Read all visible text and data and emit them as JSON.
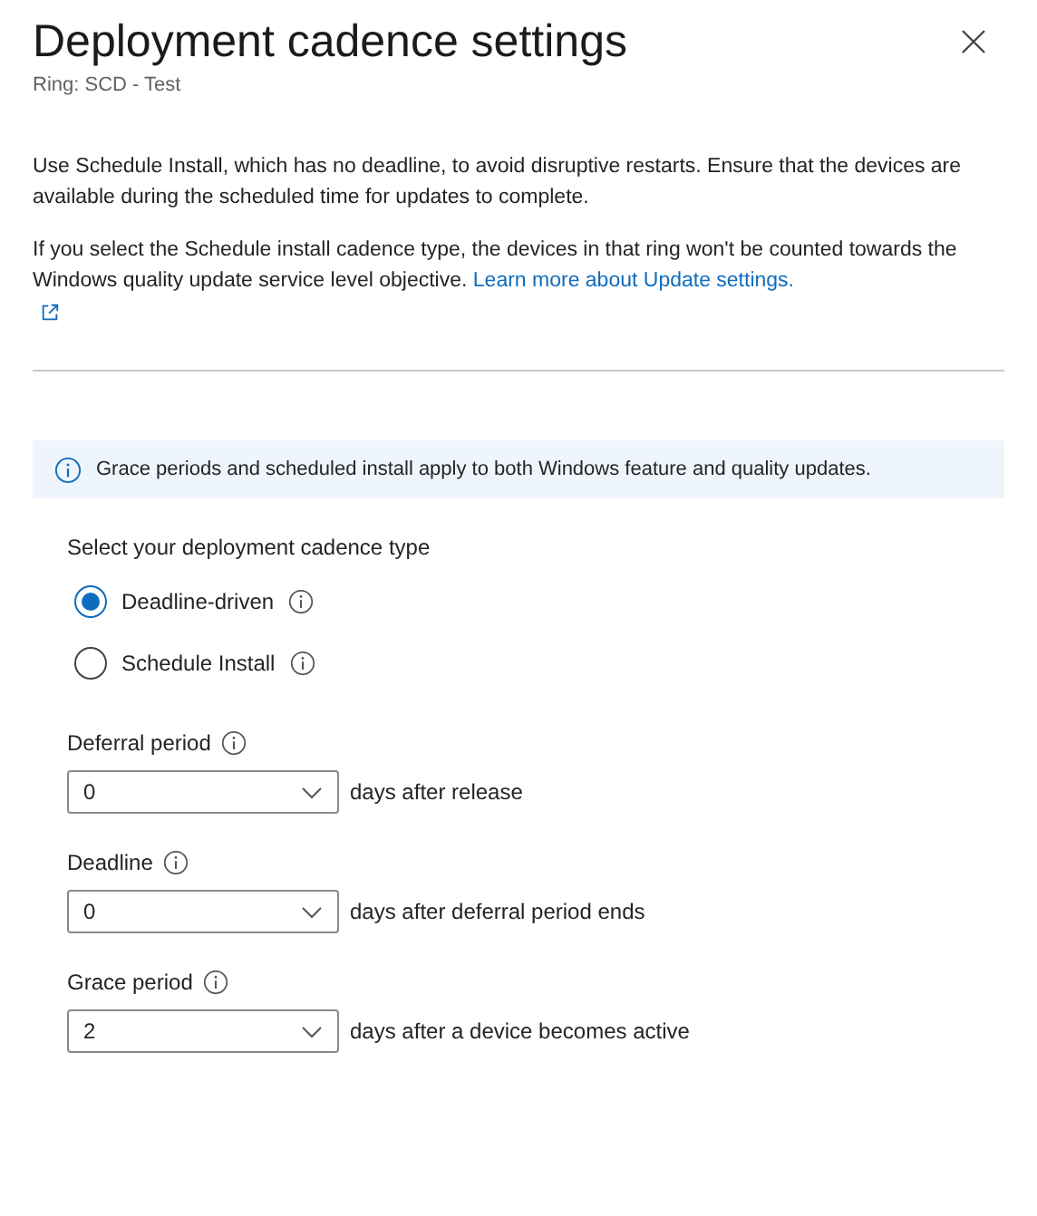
{
  "panel": {
    "title": "Deployment cadence settings",
    "subtitle": "Ring: SCD - Test"
  },
  "intro": [
    "Use Schedule Install, which has no deadline, to avoid disruptive restarts. Ensure that the devices are available during the scheduled time for updates to complete.",
    "If you select the Schedule install cadence type, the devices in that ring won't be counted towards the Windows quality update service level objective."
  ],
  "link": "Learn more about Update settings.",
  "info_banner": "Grace periods and scheduled install apply to both Windows feature and quality updates.",
  "cadence": {
    "label": "Select your deployment cadence type",
    "options": [
      {
        "label": "Deadline-driven",
        "selected": true
      },
      {
        "label": "Schedule Install",
        "selected": false
      }
    ]
  },
  "fields": [
    {
      "label": "Deferral period",
      "value": "0",
      "suffix": "days after release"
    },
    {
      "label": "Deadline",
      "value": "0",
      "suffix": "days after deferral period ends"
    },
    {
      "label": "Grace period",
      "value": "2",
      "suffix": "days after a device becomes active"
    }
  ]
}
